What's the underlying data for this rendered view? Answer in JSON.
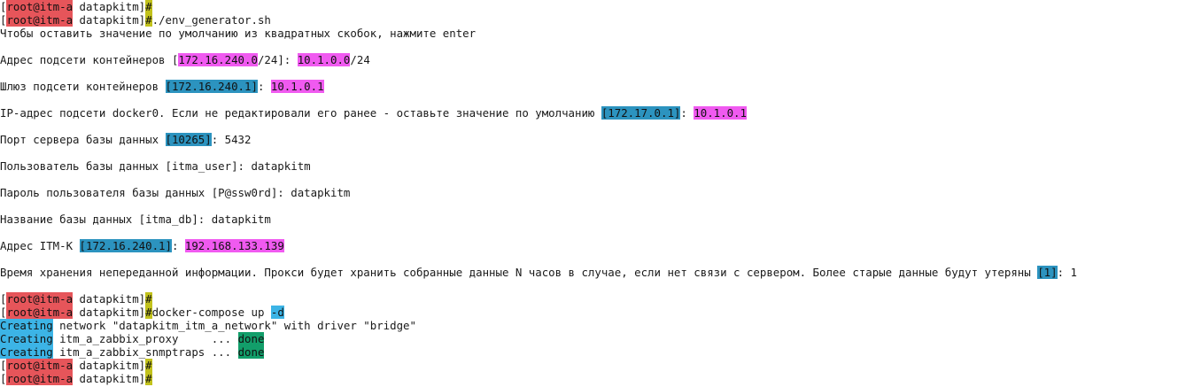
{
  "terminal": {
    "prompt": {
      "open": "[",
      "host": "root@itm-a",
      "dir": " datapkitm]",
      "symbol": "#"
    },
    "colors": {
      "host_bg": "#e6555a",
      "prompt_bg": "#c2c21b",
      "default_bg": "#2c93bf",
      "input_bg": "#f05af0",
      "creating_bg": "#3cb4e6",
      "done_bg": "#129e6a"
    },
    "cmd1": "./env_generator.sh",
    "intro": "Чтобы оставить значение по умолчанию из квадратных скобок, нажмите enter",
    "q1": {
      "label": "Адрес подсети контейнеров [",
      "def_hl": "172.16.240.0",
      "def_rest": "/24]: ",
      "val_hl": "10.1.0.0",
      "val_rest": "/24"
    },
    "q2": {
      "label": "Шлюз подсети контейнеров ",
      "def": "[172.16.240.1]",
      "sep": ": ",
      "val": "10.1.0.1"
    },
    "q3": {
      "label": "IP-адрес подсети docker0. Если не редактировали его ранее - оставьте значение по умолчанию ",
      "def": "[172.17.0.1]",
      "sep": ": ",
      "val": "10.1.0.1"
    },
    "q4": {
      "label": "Порт сервера базы данных ",
      "def": "[10265]",
      "rest": ": 5432"
    },
    "q5": {
      "text": "Пользователь базы данных [itma_user]: datapkitm"
    },
    "q6": {
      "text": "Пароль пользователя базы данных [P@ssw0rd]: datapkitm"
    },
    "q7": {
      "text": "Название базы данных [itma_db]: datapkitm"
    },
    "q8": {
      "label": "Адрес ITM-K ",
      "def": "[172.16.240.1]",
      "sep": ": ",
      "val": "192.168.133.139"
    },
    "q9": {
      "label": "Время хранения непереданной информации. Прокси будет хранить собранные данные N часов в случае, если нет связи с сервером. Более старые данные будут утеряны ",
      "def": "[1]",
      "rest": ": 1"
    },
    "cmd2": {
      "text": "docker-compose up ",
      "flag": "-d"
    },
    "out": {
      "creating": "Creating",
      "net": " network \"datapkitm_itm_a_network\" with driver \"bridge\"",
      "proxy": " itm_a_zabbix_proxy     ... ",
      "snmp": " itm_a_zabbix_snmptraps ... ",
      "done": "done"
    }
  }
}
